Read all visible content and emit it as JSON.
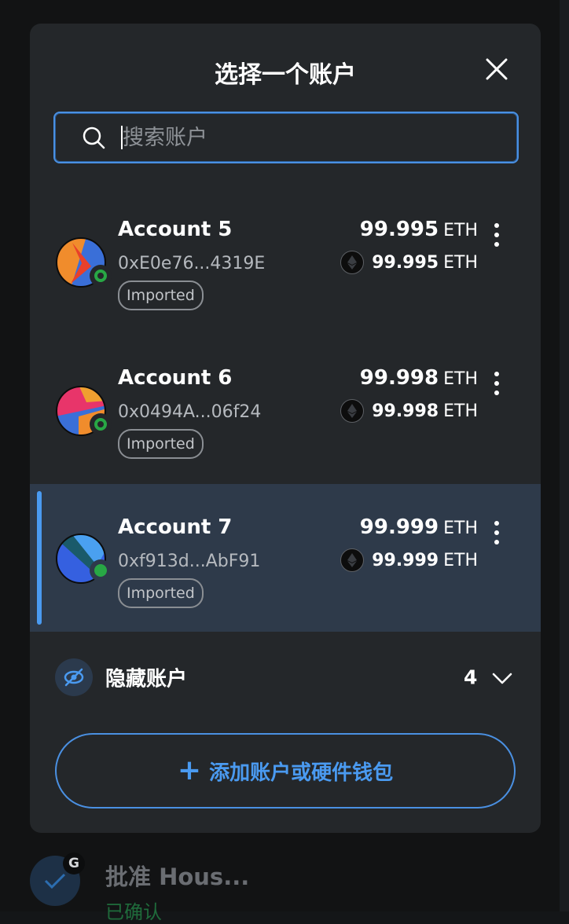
{
  "modal": {
    "title": "选择一个账户",
    "search": {
      "placeholder": "搜索账户",
      "value": ""
    },
    "accounts": [
      {
        "name": "Account 5",
        "address": "0xE0e76...4319E",
        "tag": "Imported",
        "balance": "99.995",
        "balance_unit": "ETH",
        "secondary_balance": "99.995",
        "secondary_unit": "ETH",
        "selected": false
      },
      {
        "name": "Account 6",
        "address": "0x0494A...06f24",
        "tag": "Imported",
        "balance": "99.998",
        "balance_unit": "ETH",
        "secondary_balance": "99.998",
        "secondary_unit": "ETH",
        "selected": false
      },
      {
        "name": "Account 7",
        "address": "0xf913d...AbF91",
        "tag": "Imported",
        "balance": "99.999",
        "balance_unit": "ETH",
        "secondary_balance": "99.999",
        "secondary_unit": "ETH",
        "selected": true
      }
    ],
    "hidden_accounts": {
      "label": "隐藏账户",
      "count": "4"
    },
    "add_button": {
      "label": "添加账户或硬件钱包"
    }
  },
  "background": {
    "activity": {
      "badge": "G",
      "title": "批准 Hous...",
      "status": "已确认"
    }
  },
  "colors": {
    "accent": "#4a90e2",
    "modal_bg": "#24272a",
    "selected_bg": "#2e3a4a",
    "connected": "#28a745"
  }
}
